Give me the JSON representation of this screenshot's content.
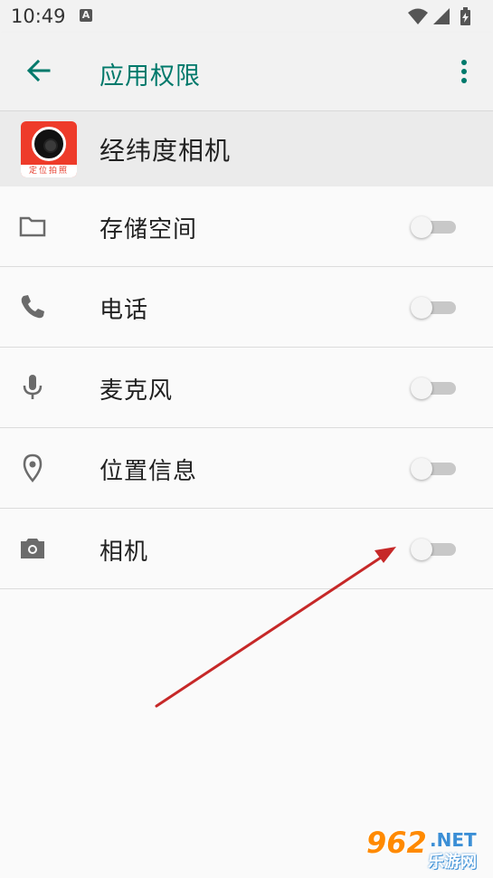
{
  "status_bar": {
    "time": "10:49",
    "notification_icon": "A",
    "icons": [
      "wifi-icon",
      "signal-icon",
      "battery-charging-icon"
    ]
  },
  "app_bar": {
    "title": "应用权限",
    "back_icon": "arrow-left-icon",
    "more_icon": "more-vert-icon"
  },
  "app_info": {
    "name": "经纬度相机",
    "icon_label": "定位拍照"
  },
  "permissions": [
    {
      "label": "存储空间",
      "icon": "folder-icon",
      "enabled": false
    },
    {
      "label": "电话",
      "icon": "phone-icon",
      "enabled": false
    },
    {
      "label": "麦克风",
      "icon": "microphone-icon",
      "enabled": false
    },
    {
      "label": "位置信息",
      "icon": "location-pin-icon",
      "enabled": false
    },
    {
      "label": "相机",
      "icon": "camera-icon",
      "enabled": false
    }
  ],
  "watermark": {
    "number": "962",
    "suffix": ".NET",
    "text": "乐游网"
  },
  "colors": {
    "accent": "#00796b",
    "annotation_arrow": "#d32f2f",
    "toggle_off_track": "#c8c8c8"
  }
}
